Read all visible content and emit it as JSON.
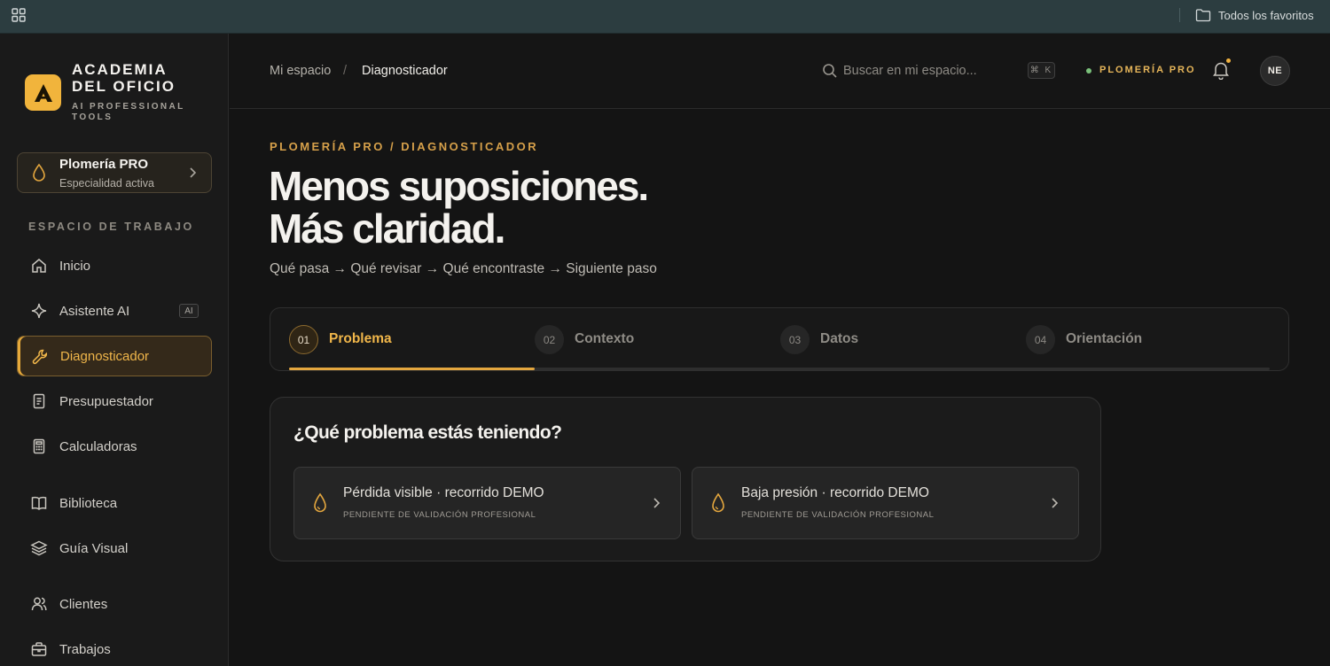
{
  "browser": {
    "favorites_label": "Todos los favoritos"
  },
  "sidebar": {
    "brand_line1": "ACADEMIA",
    "brand_line2": "DEL OFICIO",
    "brand_sub": "AI PROFESSIONAL TOOLS",
    "specialty": {
      "title": "Plomería PRO",
      "subtitle": "Especialidad activa"
    },
    "section_label": "ESPACIO DE TRABAJO",
    "items": [
      {
        "label": "Inicio",
        "icon": "home-icon"
      },
      {
        "label": "Asistente AI",
        "icon": "sparkle-icon",
        "badge": "AI"
      },
      {
        "label": "Diagnosticador",
        "icon": "wrench-icon",
        "active": true
      },
      {
        "label": "Presupuestador",
        "icon": "document-icon"
      },
      {
        "label": "Calculadoras",
        "icon": "calculator-icon"
      },
      {
        "label": "Biblioteca",
        "icon": "book-icon"
      },
      {
        "label": "Guía Visual",
        "icon": "layers-icon"
      },
      {
        "label": "Clientes",
        "icon": "users-icon"
      },
      {
        "label": "Trabajos",
        "icon": "briefcase-icon"
      }
    ]
  },
  "header": {
    "breadcrumb": [
      "Mi espacio",
      "Diagnosticador"
    ],
    "breadcrumb_separator": "/",
    "search_placeholder": "Buscar en mi espacio...",
    "shortcut": "⌘ K",
    "status": "PLOMERÍA PRO",
    "avatar_initials": "NE"
  },
  "main": {
    "eyebrow": "PLOMERÍA PRO / DIAGNOSTICADOR",
    "title_line1": "Menos suposiciones.",
    "title_line2": "Más claridad.",
    "flow": "Qué pasa → Qué revisar → Qué encontraste → Siguiente paso",
    "steps": [
      {
        "num": "01",
        "label": "Problema"
      },
      {
        "num": "02",
        "label": "Contexto"
      },
      {
        "num": "03",
        "label": "Datos"
      },
      {
        "num": "04",
        "label": "Orientación"
      }
    ],
    "active_step": 1,
    "progress_fraction": 0.25,
    "question": "¿Qué problema estás teniendo?",
    "options": [
      {
        "title": "Pérdida visible · recorrido DEMO",
        "subtitle": "PENDIENTE DE VALIDACIÓN PROFESIONAL"
      },
      {
        "title": "Baja presión · recorrido DEMO",
        "subtitle": "PENDIENTE DE VALIDACIÓN PROFESIONAL"
      }
    ]
  },
  "colors": {
    "accent": "#f0b64a",
    "logo_bg": "#f1b43c",
    "status_dot": "#7ac07a",
    "favbar_bg": "#2c3d40"
  }
}
